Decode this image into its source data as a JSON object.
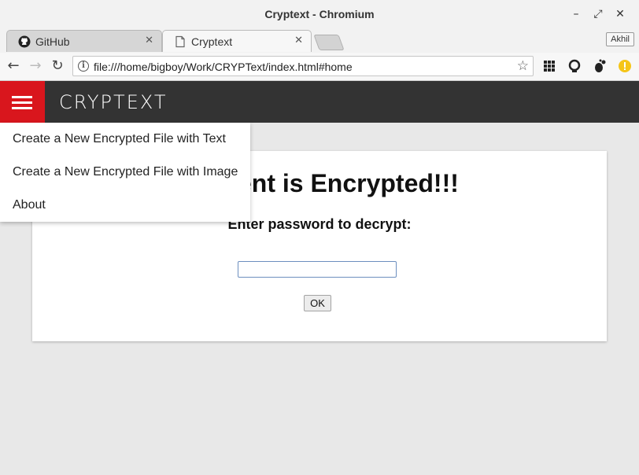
{
  "window": {
    "title": "Cryptext - Chromium"
  },
  "tabs": [
    {
      "label": "GitHub",
      "icon": "github-icon",
      "active": false
    },
    {
      "label": "Cryptext",
      "icon": "page-icon",
      "active": true
    }
  ],
  "profile": {
    "name": "Akhil"
  },
  "toolbar": {
    "url": "file:///home/bigboy/Work/CRYPText/index.html#home"
  },
  "app": {
    "logo": "CRYPTEXT",
    "menu_items": [
      {
        "label": "Create a New Encrypted File with Text"
      },
      {
        "label": "Create a New Encrypted File with Image"
      },
      {
        "label": "About"
      }
    ],
    "card": {
      "heading": "Content is Encrypted!!!",
      "prompt": "Enter password to decrypt:",
      "password_value": "",
      "ok_label": "OK"
    }
  },
  "colors": {
    "app_header": "#333333",
    "menu_button": "#d9161d",
    "page_background": "#e8e8e8"
  }
}
